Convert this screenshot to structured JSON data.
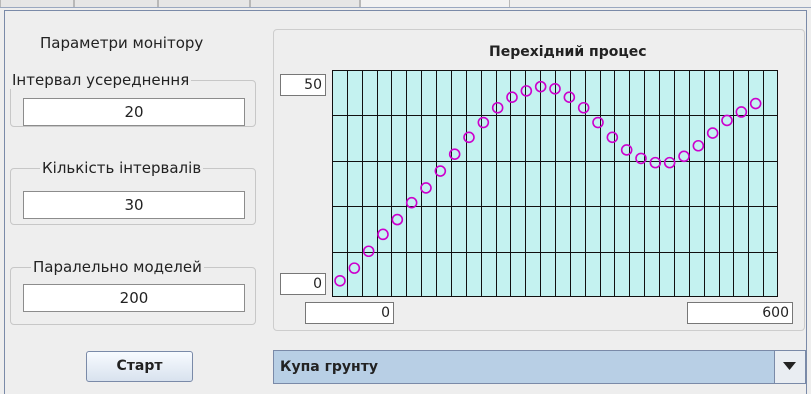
{
  "monitor": {
    "title": "Параметри монітору",
    "averaging_interval": {
      "label": "Інтервал усереднення",
      "value": "20"
    },
    "interval_count": {
      "label": "Кількість інтервалів",
      "value": "30"
    },
    "parallel_models": {
      "label": "Паралельно моделей",
      "value": "200"
    }
  },
  "chart": {
    "y_max_label": "50",
    "y_min_label": "0",
    "x_min_label": "0",
    "x_max_label": "600"
  },
  "chart_data": {
    "type": "scatter",
    "title": "Перехідний процес",
    "xlim": [
      0,
      600
    ],
    "ylim": [
      0,
      50
    ],
    "x": [
      0,
      20,
      40,
      60,
      80,
      100,
      120,
      140,
      160,
      180,
      200,
      220,
      240,
      260,
      280,
      300,
      320,
      340,
      360,
      380,
      400,
      420,
      440,
      460,
      480,
      500,
      520,
      540,
      560,
      580
    ],
    "y": [
      1,
      4,
      8,
      12,
      15.5,
      19.5,
      23,
      27,
      31,
      35,
      38.5,
      42,
      44.5,
      46,
      47,
      46.5,
      44.5,
      42,
      38.5,
      35,
      32,
      30,
      29,
      29,
      30.5,
      33,
      36,
      39,
      41,
      43
    ],
    "grid": true,
    "marker_color": "#cc00cc",
    "plot_background": "#c4f2f0"
  },
  "controls": {
    "start_label": "Старт",
    "model_select_value": "Купа грунту"
  },
  "colors": {
    "accent": "#7a8aa8",
    "select_bg": "#b8cfe5"
  }
}
